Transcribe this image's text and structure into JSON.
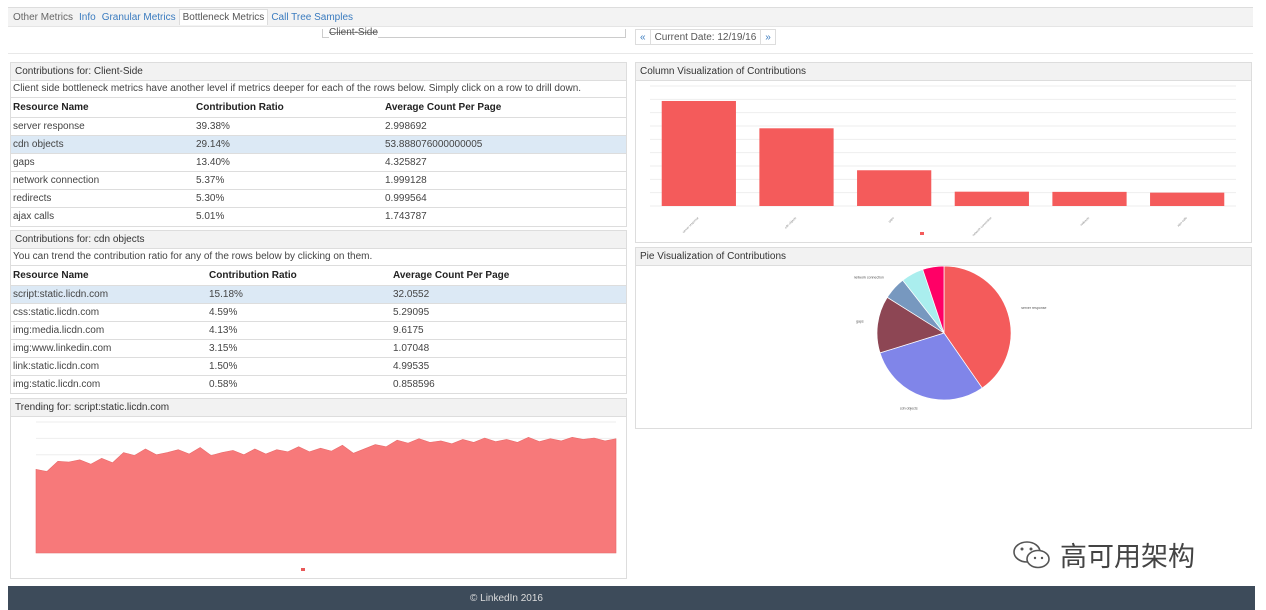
{
  "tabs": [
    {
      "label": "Other Metrics",
      "style": "plain"
    },
    {
      "label": "Info",
      "style": "link"
    },
    {
      "label": "Granular Metrics",
      "style": "link"
    },
    {
      "label": "Bottleneck Metrics",
      "style": "active"
    },
    {
      "label": "Call Tree Samples",
      "style": "link"
    }
  ],
  "selector": {
    "value": "Client-Side"
  },
  "date_nav": {
    "prev": "«",
    "label": "Current Date: 12/19/16",
    "next": "»"
  },
  "contrib": {
    "title": "Contributions for: Client-Side",
    "description": "Client side bottleneck metrics have another level if metrics deeper for each of the rows below. Simply click on a row to drill down.",
    "columns": [
      "Resource Name",
      "Contribution Ratio",
      "Average Count Per Page"
    ],
    "rows": [
      [
        "server response",
        "39.38%",
        "2.998692"
      ],
      [
        "cdn objects",
        "29.14%",
        "53.888076000000005"
      ],
      [
        "gaps",
        "13.40%",
        "4.325827"
      ],
      [
        "network connection",
        "5.37%",
        "1.999128"
      ],
      [
        "redirects",
        "5.30%",
        "0.999564"
      ],
      [
        "ajax calls",
        "5.01%",
        "1.743787"
      ]
    ],
    "selected": 1
  },
  "cdn": {
    "title": "Contributions for: cdn objects",
    "description": "You can trend the contribution ratio for any of the rows below by clicking on them.",
    "columns": [
      "Resource Name",
      "Contribution Ratio",
      "Average Count Per Page"
    ],
    "rows": [
      [
        "script:static.licdn.com",
        "15.18%",
        "32.0552"
      ],
      [
        "css:static.licdn.com",
        "4.59%",
        "5.29095"
      ],
      [
        "img:media.licdn.com",
        "4.13%",
        "9.6175"
      ],
      [
        "img:www.linkedin.com",
        "3.15%",
        "1.07048"
      ],
      [
        "link:static.licdn.com",
        "1.50%",
        "4.99535"
      ],
      [
        "img:static.licdn.com",
        "0.58%",
        "0.858596"
      ]
    ],
    "selected": 0
  },
  "trend": {
    "title": "Trending for: script:static.licdn.com"
  },
  "column_panel": {
    "title": "Column Visualization of Contributions"
  },
  "pie_panel": {
    "title": "Pie Visualization of Contributions"
  },
  "chart_data": [
    {
      "type": "bar",
      "categories": [
        "server response",
        "cdn objects",
        "gaps",
        "network connection",
        "redirects",
        "ajax calls"
      ],
      "values": [
        39.38,
        29.14,
        13.4,
        5.37,
        5.3,
        5.01
      ],
      "ylim": [
        0,
        45
      ],
      "grid": true,
      "color": "#f45b5b"
    },
    {
      "type": "pie",
      "categories": [
        "server response",
        "cdn objects",
        "gaps",
        "network connection",
        "redirects",
        "ajax calls"
      ],
      "values": [
        39.38,
        29.14,
        13.4,
        5.37,
        5.3,
        5.01
      ],
      "colors": [
        "#f45b5b",
        "#8085e9",
        "#8d4654",
        "#7798bf",
        "#aaeeee",
        "#ff0066"
      ]
    },
    {
      "type": "area",
      "values": [
        11.5,
        11.2,
        12.6,
        12.5,
        12.8,
        12.2,
        13.0,
        12.4,
        13.8,
        13.4,
        14.3,
        13.5,
        13.8,
        14.2,
        13.6,
        14.5,
        13.4,
        13.8,
        14.1,
        13.5,
        14.3,
        13.6,
        14.2,
        13.9,
        14.6,
        13.9,
        14.4,
        14.0,
        14.8,
        13.7,
        14.3,
        14.9,
        14.6,
        15.5,
        15.1,
        15.7,
        15.2,
        15.4,
        15.0,
        15.6,
        15.2,
        15.8,
        15.3,
        15.6,
        15.2,
        15.9,
        15.3,
        15.7,
        15.4,
        15.9,
        15.6,
        15.8,
        15.4,
        15.7
      ],
      "ylim": [
        0,
        18
      ],
      "color": "#f7797a"
    }
  ],
  "watermark": "高可用架构",
  "footer": "© LinkedIn 2016"
}
